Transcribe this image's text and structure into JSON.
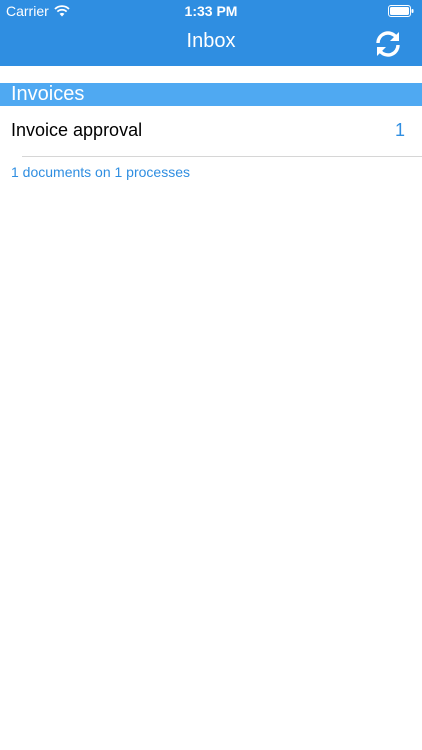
{
  "status_bar": {
    "carrier": "Carrier",
    "time": "1:33 PM",
    "wifi_icon": "wifi-icon",
    "battery_icon": "battery-icon"
  },
  "nav": {
    "title": "Inbox",
    "refresh_icon": "refresh-icon"
  },
  "section": {
    "title": "Invoices",
    "items": [
      {
        "label": "Invoice approval",
        "count": "1"
      }
    ]
  },
  "summary": "1 documents on 1 processes",
  "colors": {
    "nav_background": "#2f8ee1",
    "section_header": "#4fa9f2",
    "accent": "#2f8ee1"
  }
}
